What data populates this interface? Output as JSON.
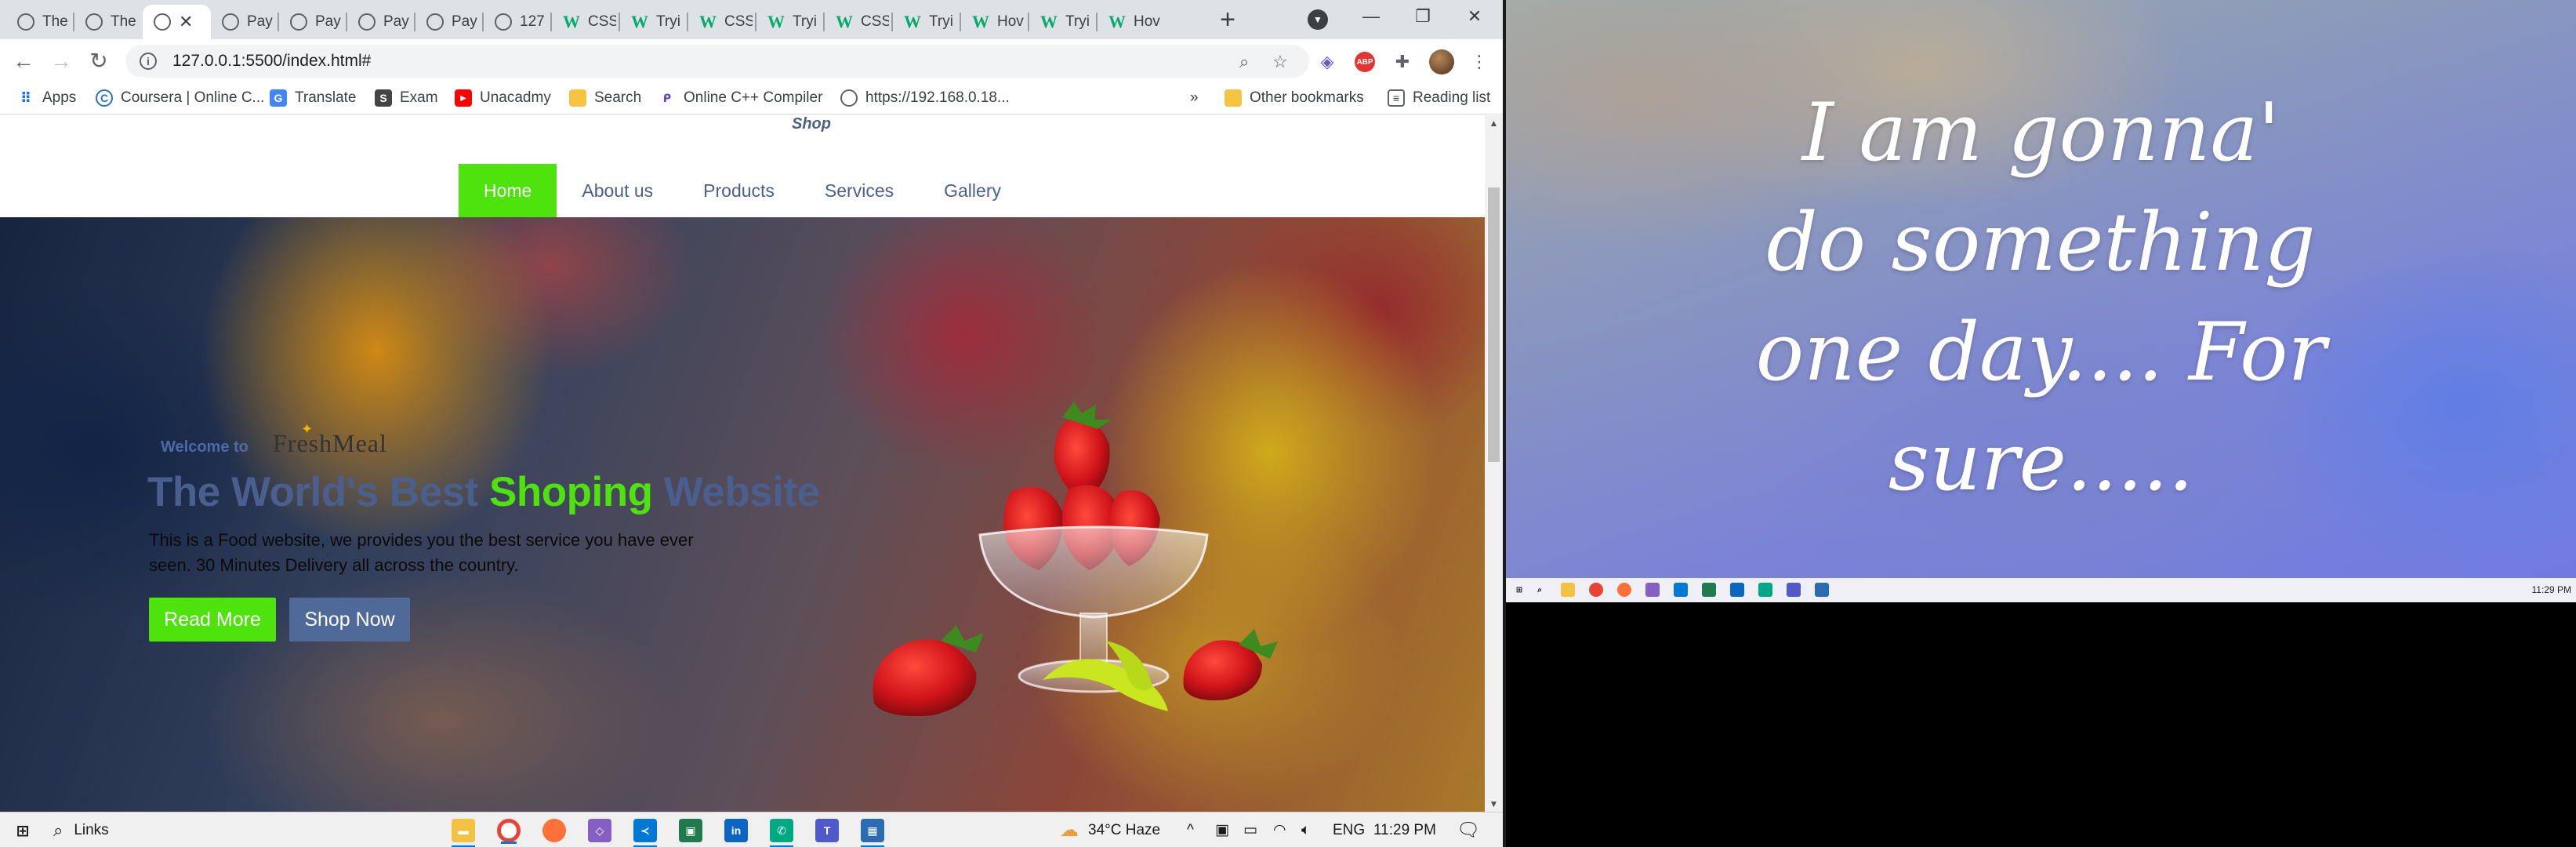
{
  "browser": {
    "tabs": [
      {
        "label": "The",
        "icon": "globe"
      },
      {
        "label": "The",
        "icon": "globe"
      },
      {
        "label": "",
        "icon": "globe",
        "active": true
      },
      {
        "label": "Pay",
        "icon": "globe"
      },
      {
        "label": "Pay",
        "icon": "globe"
      },
      {
        "label": "Pay",
        "icon": "globe"
      },
      {
        "label": "Pay",
        "icon": "globe"
      },
      {
        "label": "127",
        "icon": "globe"
      },
      {
        "label": "CSS",
        "icon": "w3"
      },
      {
        "label": "Tryi",
        "icon": "w3"
      },
      {
        "label": "CSS",
        "icon": "w3"
      },
      {
        "label": "Tryi",
        "icon": "w3"
      },
      {
        "label": "CSS",
        "icon": "w3"
      },
      {
        "label": "Tryi",
        "icon": "w3"
      },
      {
        "label": "Hov",
        "icon": "w3"
      },
      {
        "label": "Tryi",
        "icon": "w3"
      },
      {
        "label": "Hov",
        "icon": "w3"
      }
    ],
    "url": "127.0.0.1:5500/index.html#",
    "bookmarks": {
      "apps": "Apps",
      "coursera": "Coursera | Online C...",
      "translate": "Translate",
      "exam": "Exam",
      "unacadmy": "Unacadmy",
      "search": "Search",
      "cpp": "Online C++ Compiler",
      "ip": "https://192.168.0.18...",
      "more": "»",
      "other": "Other bookmarks",
      "reading": "Reading list"
    }
  },
  "site": {
    "shop_label": "Shop",
    "nav": [
      "Home",
      "About us",
      "Products",
      "Services",
      "Gallery"
    ],
    "welcome": "Welcome to",
    "logo": "FreshMeal",
    "headline": {
      "part1": "The World's Best ",
      "highlight": "Shoping",
      "part2": " Website"
    },
    "description": "This is a Food website, we provides you the best service you have ever seen. 30 Minutes Delivery all across the country.",
    "read_more": "Read More",
    "shop_now": "Shop Now",
    "colors": {
      "accent": "#4fe30e",
      "primary": "#4a5f8e"
    }
  },
  "taskbar": {
    "search_label": "Links",
    "weather": "34°C  Haze",
    "language": "ENG",
    "time": "11:29 PM"
  },
  "remote": {
    "quote_lines": [
      "I am gonna'",
      "do something",
      "one day.... For",
      "sure....."
    ],
    "clock": "11:29 PM"
  }
}
